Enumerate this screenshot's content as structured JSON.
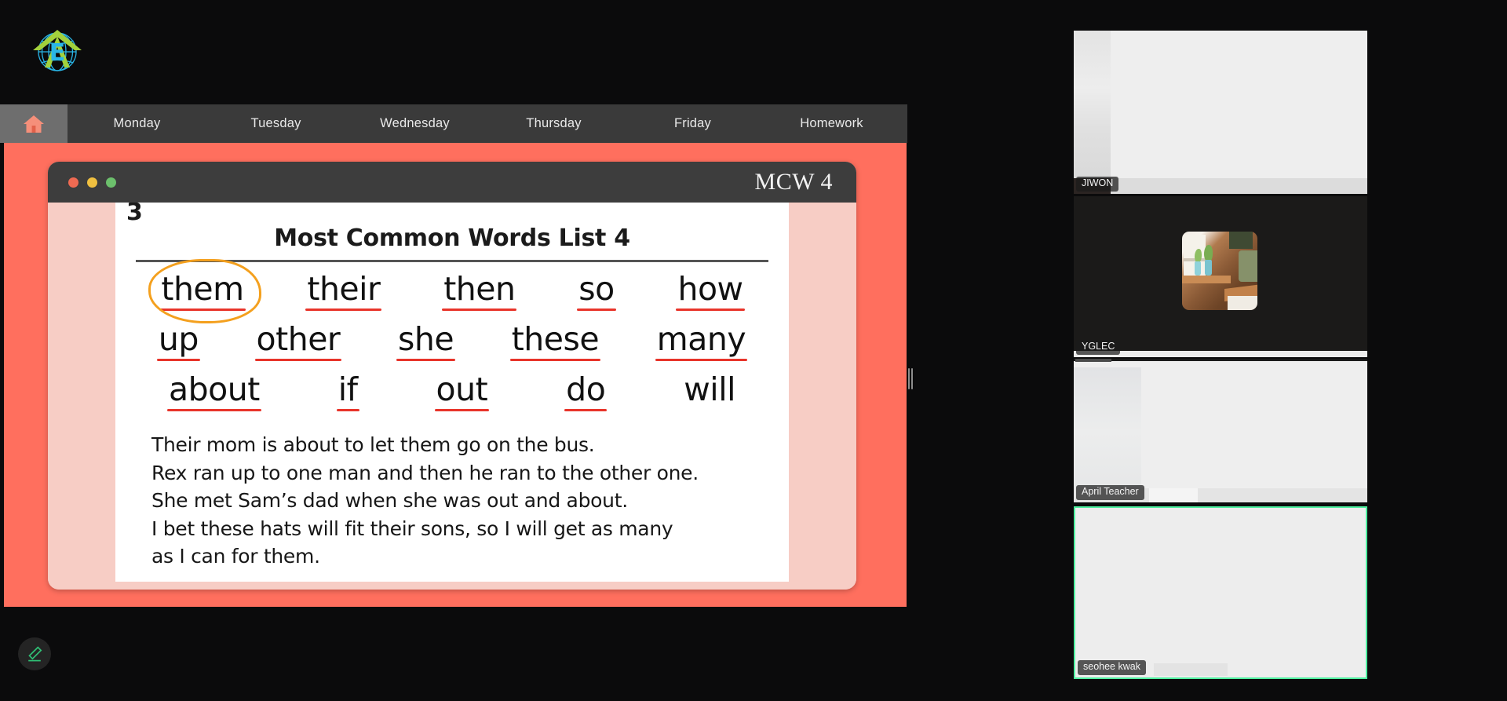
{
  "app": {
    "logo_alt": "ENVIRONMENT-GLOBE-LOGO",
    "logo_letter": "E",
    "logo_colors": {
      "arrow": "#a3d23c",
      "globe": "#29b6e8"
    },
    "background": "#0b0b0c"
  },
  "nav": {
    "home_icon": "home-icon",
    "active_tab": "Home",
    "accent": "#ff6f5e",
    "bar_bg": "#3a3a3a",
    "tabs": [
      {
        "label": "Monday"
      },
      {
        "label": "Tuesday"
      },
      {
        "label": "Wednesday"
      },
      {
        "label": "Thursday"
      },
      {
        "label": "Friday"
      },
      {
        "label": "Homework"
      }
    ]
  },
  "slide_window": {
    "title": "MCW 4",
    "traffic_lights": [
      "close-red",
      "minimize-yellow",
      "maximize-green"
    ],
    "page_number": "3"
  },
  "slide": {
    "heading": "Most Common Words List 4",
    "word_rows": [
      [
        {
          "text": "them",
          "underlined": true,
          "circled": true
        },
        {
          "text": "their",
          "underlined": true,
          "circled": false
        },
        {
          "text": "then",
          "underlined": true,
          "circled": false
        },
        {
          "text": "so",
          "underlined": true,
          "circled": false
        },
        {
          "text": "how",
          "underlined": true,
          "circled": false
        }
      ],
      [
        {
          "text": "up",
          "underlined": true,
          "circled": false
        },
        {
          "text": "other",
          "underlined": true,
          "circled": false
        },
        {
          "text": "she",
          "underlined": true,
          "circled": false
        },
        {
          "text": "these",
          "underlined": true,
          "circled": false
        },
        {
          "text": "many",
          "underlined": true,
          "circled": false
        }
      ],
      [
        {
          "text": "about",
          "underlined": true,
          "circled": false
        },
        {
          "text": "if",
          "underlined": true,
          "circled": false
        },
        {
          "text": "out",
          "underlined": true,
          "circled": false
        },
        {
          "text": "do",
          "underlined": true,
          "circled": false
        },
        {
          "text": "will",
          "underlined": false,
          "circled": false
        }
      ]
    ],
    "sentences": [
      "Their mom is about to let them go on the bus.",
      "Rex ran up to one man and then he ran to the other one.",
      "She met Sam’s dad when she was out and about.",
      "I bet these hats will fit their sons, so I will get as many",
      "as I can for them."
    ],
    "annotation_colors": {
      "underline": "#e8342a",
      "circle": "#f4a01e"
    }
  },
  "drag_handle": {
    "name": "panel-resize-handle"
  },
  "edit_button": {
    "icon": "pencil-edit-icon",
    "color": "#2fbf74"
  },
  "participants": [
    {
      "name": "JIWON",
      "active_speaker": false
    },
    {
      "name": "YGLEC",
      "active_speaker": false
    },
    {
      "name": "April Teacher",
      "active_speaker": false
    },
    {
      "name": "seohee kwak",
      "active_speaker": true
    }
  ],
  "active_speaker_color": "#4ef0a0"
}
